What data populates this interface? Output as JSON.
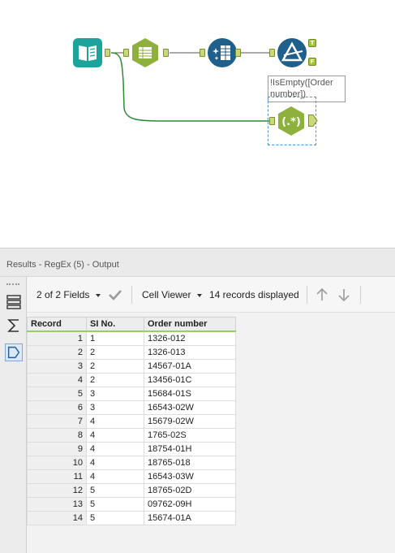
{
  "canvas": {
    "tools": [
      {
        "id": "input",
        "name": "input-data-tool",
        "icon": "book-icon",
        "color": "#1ba39c"
      },
      {
        "id": "select",
        "name": "select-tool",
        "icon": "list-columns-icon",
        "color": "#8db13c"
      },
      {
        "id": "crosstab",
        "name": "transform-tool",
        "icon": "sparkle-table-icon",
        "color": "#1f5f8b"
      },
      {
        "id": "filter",
        "name": "filter-tool",
        "icon": "delta-filter-icon",
        "color": "#1f5f8b"
      },
      {
        "id": "regex",
        "name": "regex-tool",
        "icon": "regex-icon",
        "color": "#8db13c"
      }
    ],
    "filter_anchors": {
      "true": "T",
      "false": "F"
    },
    "annotation": "!IsEmpty([Order number])"
  },
  "results": {
    "title": "Results - RegEx (5) - Output",
    "toolbar": {
      "fields_label": "2 of 2 Fields",
      "viewer_label": "Cell Viewer",
      "records_label": "14 records displayed"
    },
    "columns": [
      "Record",
      "SI No.",
      "Order number"
    ],
    "rows": [
      [
        "1",
        "1",
        "1326-012"
      ],
      [
        "2",
        "2",
        "1326-013"
      ],
      [
        "3",
        "2",
        "14567-01A"
      ],
      [
        "4",
        "2",
        "13456-01C"
      ],
      [
        "5",
        "3",
        "15684-01S"
      ],
      [
        "6",
        "3",
        "16543-02W"
      ],
      [
        "7",
        "4",
        "15679-02W"
      ],
      [
        "8",
        "4",
        "1765-02S"
      ],
      [
        "9",
        "4",
        "18754-01H"
      ],
      [
        "10",
        "4",
        "18765-018"
      ],
      [
        "11",
        "4",
        "16543-03W"
      ],
      [
        "12",
        "5",
        "18765-02D"
      ],
      [
        "13",
        "5",
        "09762-09H"
      ],
      [
        "14",
        "5",
        "15674-01A"
      ]
    ],
    "colors": {
      "header_underline": "#9ccc65",
      "accent_green": "#8db13c",
      "accent_teal": "#1ba39c",
      "accent_blue": "#1f5f8b"
    }
  }
}
